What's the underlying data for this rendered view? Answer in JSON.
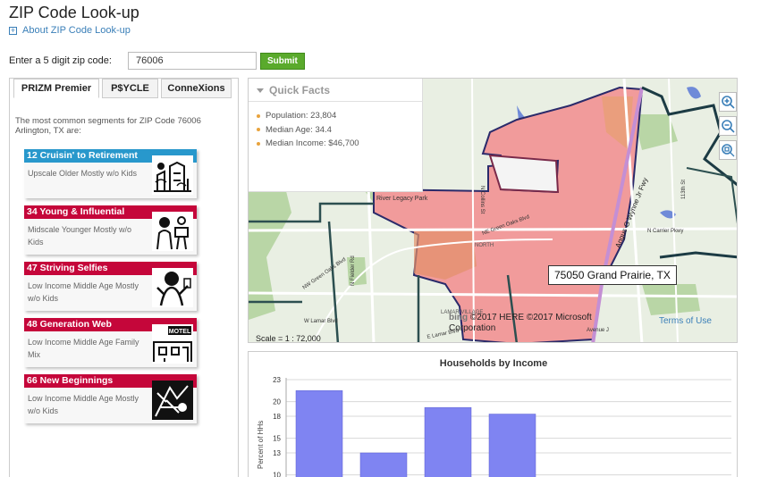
{
  "page": {
    "title": "ZIP Code Look-up",
    "about_link": "About ZIP Code Look-up",
    "zip_label": "Enter a 5 digit zip code:",
    "zip_value": "76006",
    "submit_label": "Submit"
  },
  "tabs": [
    "PRIZM Premier",
    "P$YCLE",
    "ConneXions"
  ],
  "segments": {
    "intro": "The most common segments for ZIP Code 76006 Arlington, TX are:",
    "items": [
      {
        "title": "12 Cruisin' to Retirement",
        "desc": "Upscale Older Mostly w/o Kids"
      },
      {
        "title": "34 Young & Influential",
        "desc": "Midscale Younger Mostly w/o Kids"
      },
      {
        "title": "47 Striving Selfies",
        "desc": "Low Income Middle Age Mostly w/o Kids"
      },
      {
        "title": "48 Generation Web",
        "desc": "Low Income Middle Age Family Mix"
      },
      {
        "title": "66 New Beginnings",
        "desc": "Low Income Middle Age Mostly w/o Kids"
      }
    ]
  },
  "quick_facts": {
    "title": "Quick Facts",
    "items": [
      "Population: 23,804",
      "Median Age: 34.4",
      "Median Income: $46,700"
    ]
  },
  "map": {
    "zip_popup": "75050 Grand Prairie, TX",
    "credit": "©2017 HERE ©2017 Microsoft Corporation",
    "bing": "bing",
    "terms": "Terms of Use",
    "scale": "Scale = 1 : 72,000",
    "labels": {
      "river": "River Legacy Park",
      "collins": "N Collins St",
      "green_oaks": "NE Green Oaks Blvd",
      "carrier": "N Carrier Pkwy",
      "lamar": "W Lamar Blvd",
      "lamar2": "E Lamar Blvd",
      "fielder": "N Fielder Rd",
      "nw_green": "NW Green Oaks Blvd",
      "wolf": "Angus G Wynne Jr Fwy",
      "north": "NORTH",
      "lamar_village": "LAMAR VILLAGE",
      "st113": "113th St",
      "ave_j": "Avenue J"
    }
  },
  "chart_data": {
    "type": "bar",
    "title": "Households by Income",
    "ylabel": "Percent of HHs",
    "yticks": [
      "23",
      "20",
      "18",
      "15",
      "13",
      "10"
    ],
    "ylim": [
      10,
      23
    ],
    "values": [
      21.5,
      13,
      19.2,
      18.3
    ],
    "bar_color": "#7f84f2"
  }
}
